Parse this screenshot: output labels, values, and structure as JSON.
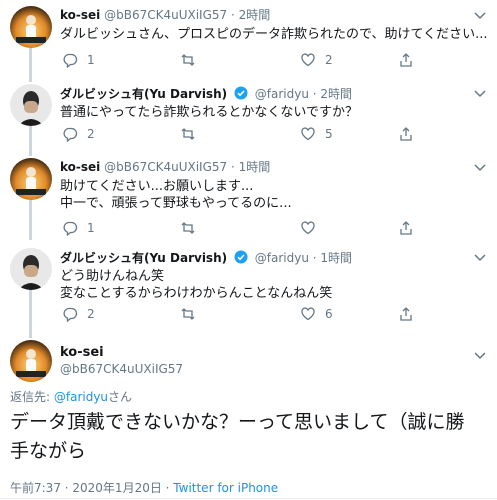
{
  "tweets": [
    {
      "name": "ko-sei",
      "handle": "@bB67CK4uUXiIG57",
      "sep": "·",
      "time": "2時間",
      "lines": [
        "ダルビッシュさん、プロスピのデータ詐欺られたので、助けてください..."
      ],
      "replies": "1",
      "retweets": "",
      "likes": "2"
    },
    {
      "name": "ダルビッシュ有(Yu Darvish)",
      "handle": "@faridyu",
      "sep": "·",
      "time": "2時間",
      "lines": [
        "普通にやってたら詐欺られるとかなくないですか？"
      ],
      "replies": "2",
      "retweets": "",
      "likes": "5"
    },
    {
      "name": "ko-sei",
      "handle": "@bB67CK4uUXiIG57",
      "sep": "·",
      "time": "1時間",
      "lines": [
        "助けてください...お願いします...",
        "中一で、頑張って野球もやってるのに..."
      ],
      "replies": "1",
      "retweets": "",
      "likes": ""
    },
    {
      "name": "ダルビッシュ有(Yu Darvish)",
      "handle": "@faridyu",
      "sep": "·",
      "time": "1時間",
      "lines": [
        "どう助けんねん笑",
        "変なことするからわけわからんことなんねん笑"
      ],
      "replies": "2",
      "retweets": "",
      "likes": "6"
    }
  ],
  "main": {
    "name": "ko-sei",
    "handle": "@bB67CK4uUXiIG57",
    "reply_prefix": "返信先: ",
    "reply_target": "@faridyu",
    "reply_suffix": "さん",
    "text_line1": "データ頂戴できないかな？ーって思いまして（誠に勝",
    "text_line2": "手ながら",
    "timestamp": "午前7:37 · 2020年1月20日 · ",
    "source": "Twitter for iPhone"
  },
  "colors": {
    "text": "#14171a",
    "secondary": "#657786",
    "link": "#1b95e0",
    "verified": "#1da1f2",
    "line": "#ccd6dd"
  }
}
